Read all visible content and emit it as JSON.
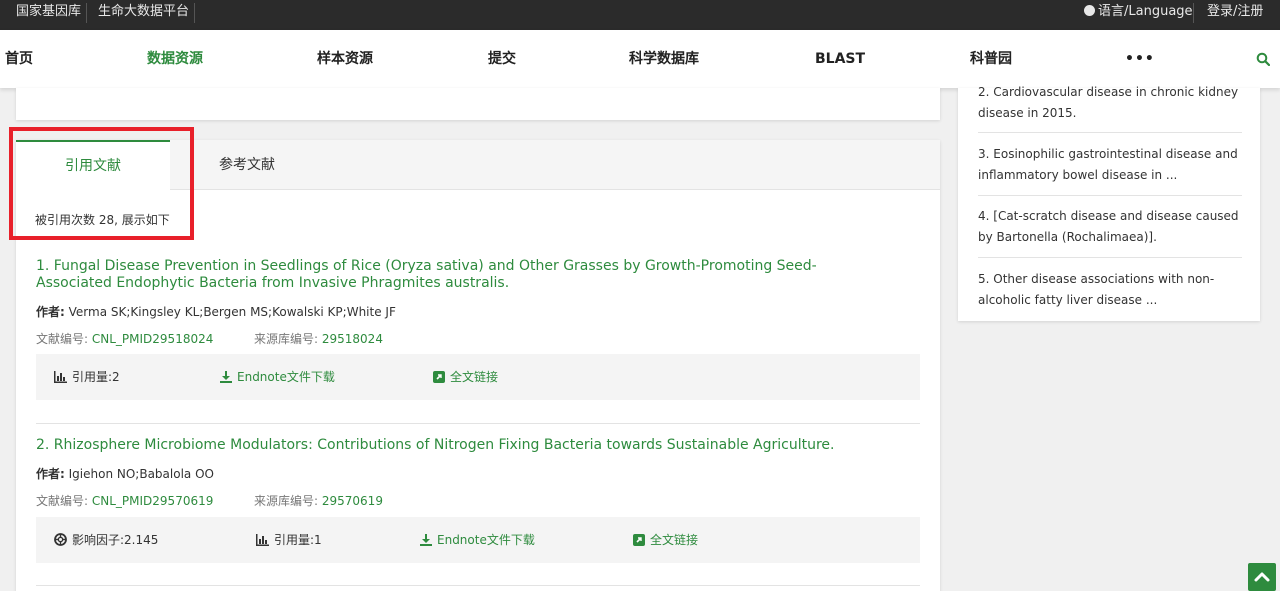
{
  "topbar": {
    "left_links": [
      "国家基因库",
      "生命大数据平台"
    ],
    "language": "语言/Language",
    "login": "登录/注册"
  },
  "nav": {
    "items": [
      "首页",
      "数据资源",
      "样本资源",
      "提交",
      "科学数据库",
      "BLAST",
      "科普园",
      "•••"
    ],
    "active_index": 1
  },
  "tabs": {
    "cited": "引用文献",
    "references": "参考文献"
  },
  "cite_count_text": "被引用次数 28, 展示如下",
  "labels": {
    "author": "作者:",
    "doc_id": "文献编号:",
    "source_id": "来源库编号:",
    "citations": "引用量:",
    "endnote": "Endnote文件下载",
    "fulltext": "全文链接",
    "impact": "影响因子:"
  },
  "entries": [
    {
      "title": "1. Fungal Disease Prevention in Seedlings of Rice (Oryza sativa) and Other Grasses by Growth-Promoting Seed-Associated Endophytic Bacteria from Invasive Phragmites australis.",
      "authors": "Verma SK;Kingsley KL;Bergen MS;Kowalski KP;White JF",
      "doc_id": "CNL_PMID29518024",
      "source_id": "29518024",
      "citations": "2"
    },
    {
      "title": "2. Rhizosphere Microbiome Modulators: Contributions of Nitrogen Fixing Bacteria towards Sustainable Agriculture.",
      "authors": "Igiehon NO;Babalola OO",
      "doc_id": "CNL_PMID29570619",
      "source_id": "29570619",
      "impact": "2.145",
      "citations": "1"
    }
  ],
  "sidebar": {
    "items": [
      "2. Cardiovascular disease in chronic kidney disease in 2015.",
      "3. Eosinophilic gastrointestinal disease and inflammatory bowel disease in ...",
      "4. [Cat-scratch disease and disease caused by Bartonella (Rochalimaea)].",
      "5. Other disease associations with non-alcoholic fatty liver disease ..."
    ]
  },
  "colors": {
    "accent": "#2e8b3e",
    "highlight": "#e8202a",
    "topbar": "#2b2b2b"
  }
}
